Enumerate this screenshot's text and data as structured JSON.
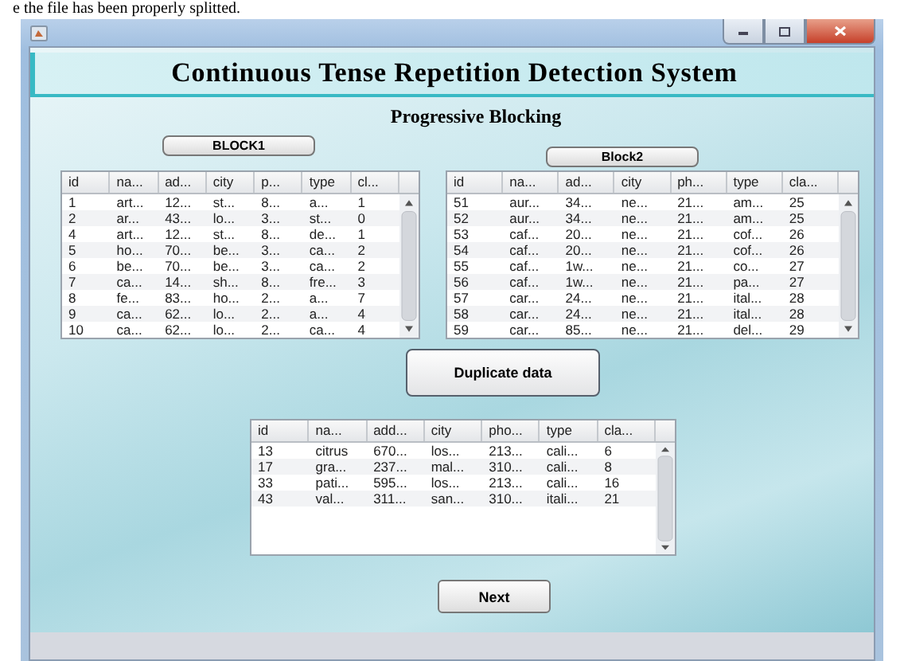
{
  "page_text": "e the file has been properly splitted.",
  "window": {
    "title_banner": "Continuous Tense Repetition Detection System",
    "subtitle": "Progressive Blocking"
  },
  "block1": {
    "button": "BLOCK1",
    "table": {
      "columns": [
        "id",
        "na...",
        "ad...",
        "city",
        "p...",
        "type",
        "cl..."
      ],
      "rows": [
        [
          "1",
          "art...",
          "12...",
          "st...",
          "8...",
          "a...",
          "1"
        ],
        [
          "2",
          "ar...",
          "43...",
          "lo...",
          "3...",
          "st...",
          "0"
        ],
        [
          "4",
          "art...",
          "12...",
          "st...",
          "8...",
          "de...",
          "1"
        ],
        [
          "5",
          "ho...",
          "70...",
          "be...",
          "3...",
          "ca...",
          "2"
        ],
        [
          "6",
          "be...",
          "70...",
          "be...",
          "3...",
          "ca...",
          "2"
        ],
        [
          "7",
          "ca...",
          "14...",
          "sh...",
          "8...",
          "fre...",
          "3"
        ],
        [
          "8",
          "fe...",
          "83...",
          "ho...",
          "2...",
          "a...",
          "7"
        ],
        [
          "9",
          "ca...",
          "62...",
          "lo...",
          "2...",
          "a...",
          "4"
        ],
        [
          "10",
          "ca...",
          "62...",
          "lo...",
          "2...",
          "ca...",
          "4"
        ]
      ]
    }
  },
  "block2": {
    "button": "Block2",
    "table": {
      "columns": [
        "id",
        "na...",
        "ad...",
        "city",
        "ph...",
        "type",
        "cla..."
      ],
      "rows": [
        [
          "51",
          "aur...",
          "34...",
          "ne...",
          "21...",
          "am...",
          "25"
        ],
        [
          "52",
          "aur...",
          "34...",
          "ne...",
          "21...",
          "am...",
          "25"
        ],
        [
          "53",
          "caf...",
          "20...",
          "ne...",
          "21...",
          "cof...",
          "26"
        ],
        [
          "54",
          "caf...",
          "20...",
          "ne...",
          "21...",
          "cof...",
          "26"
        ],
        [
          "55",
          "caf...",
          "1w...",
          "ne...",
          "21...",
          "co...",
          "27"
        ],
        [
          "56",
          "caf...",
          "1w...",
          "ne...",
          "21...",
          "pa...",
          "27"
        ],
        [
          "57",
          "car...",
          "24...",
          "ne...",
          "21...",
          "ital...",
          "28"
        ],
        [
          "58",
          "car...",
          "24...",
          "ne...",
          "21...",
          "ital...",
          "28"
        ],
        [
          "59",
          "car...",
          "85...",
          "ne...",
          "21...",
          "del...",
          "29"
        ]
      ]
    }
  },
  "duplicate_button": "Duplicate data",
  "duplicates_table": {
    "columns": [
      "id",
      "na...",
      "add...",
      "city",
      "pho...",
      "type",
      "cla..."
    ],
    "rows": [
      [
        "13",
        "citrus",
        "670...",
        "los...",
        "213...",
        "cali...",
        "6"
      ],
      [
        "17",
        "gra...",
        "237...",
        "mal...",
        "310...",
        "cali...",
        "8"
      ],
      [
        "33",
        "pati...",
        "595...",
        "los...",
        "213...",
        "cali...",
        "16"
      ],
      [
        "43",
        "val...",
        "311...",
        "san...",
        "310...",
        "itali...",
        "21"
      ]
    ]
  },
  "next_button": "Next"
}
